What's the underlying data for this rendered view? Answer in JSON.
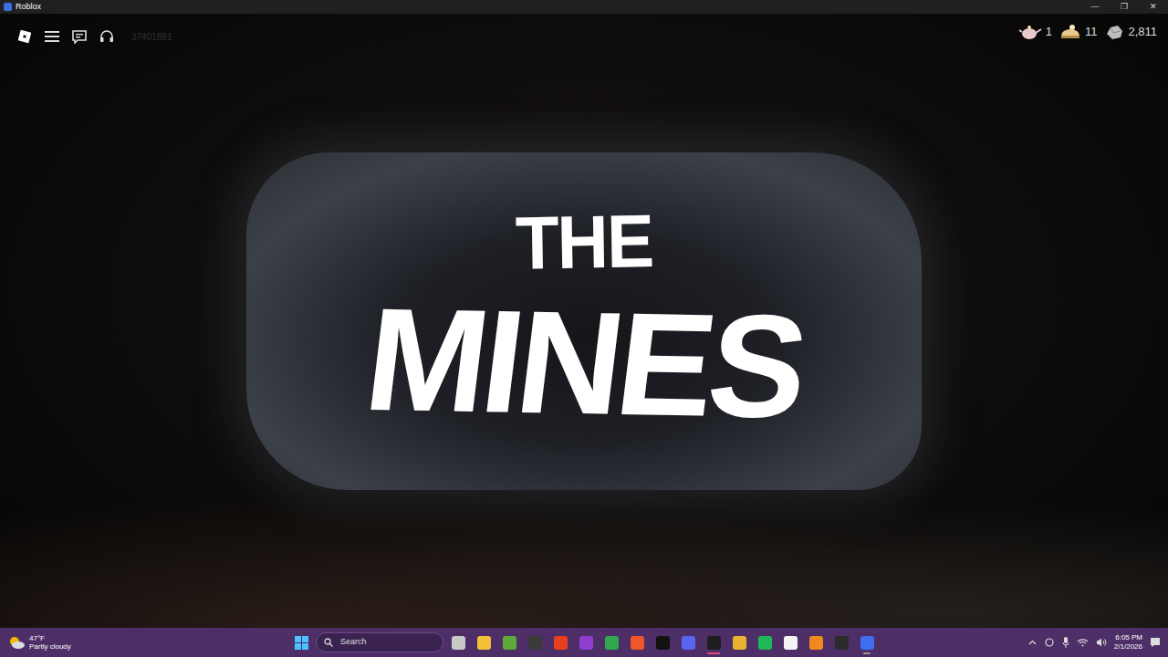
{
  "window": {
    "title": "Roblox",
    "controls": [
      "—",
      "❐",
      "✕"
    ]
  },
  "topbar": {
    "id_text": "37401881"
  },
  "currencies": [
    {
      "amount": "1"
    },
    {
      "amount": "11"
    },
    {
      "amount": "2,811"
    }
  ],
  "logo": {
    "line1": "THE",
    "line2": "MINES"
  },
  "taskbar": {
    "weather": {
      "temp": "47°F",
      "condition": "Partly cloudy"
    },
    "search": {
      "placeholder": "Search"
    },
    "apps": [
      {
        "color": "#c9c9c9",
        "running": false,
        "selected": false
      },
      {
        "color": "#f2c037",
        "running": false,
        "selected": false
      },
      {
        "color": "#5fa83a",
        "running": false,
        "selected": false
      },
      {
        "color": "#3a3a3a",
        "running": false,
        "selected": false
      },
      {
        "color": "#e8401c",
        "running": false,
        "selected": false
      },
      {
        "color": "#8e3fd0",
        "running": false,
        "selected": false
      },
      {
        "color": "#2fa84f",
        "running": false,
        "selected": false
      },
      {
        "color": "#f0562b",
        "running": false,
        "selected": false
      },
      {
        "color": "#111111",
        "running": false,
        "selected": false
      },
      {
        "color": "#5865f2",
        "running": false,
        "selected": false
      },
      {
        "color": "#1e1e1e",
        "running": true,
        "selected": true
      },
      {
        "color": "#e9b330",
        "running": false,
        "selected": false
      },
      {
        "color": "#1db954",
        "running": false,
        "selected": false
      },
      {
        "color": "#f3f3f3",
        "running": false,
        "selected": false
      },
      {
        "color": "#f08a1c",
        "running": false,
        "selected": false
      },
      {
        "color": "#2b2b2b",
        "running": false,
        "selected": false
      },
      {
        "color": "#3d6ff0",
        "running": true,
        "selected": false
      }
    ],
    "clock": {
      "time": "6:05 PM",
      "date": "2/1/2026"
    }
  }
}
